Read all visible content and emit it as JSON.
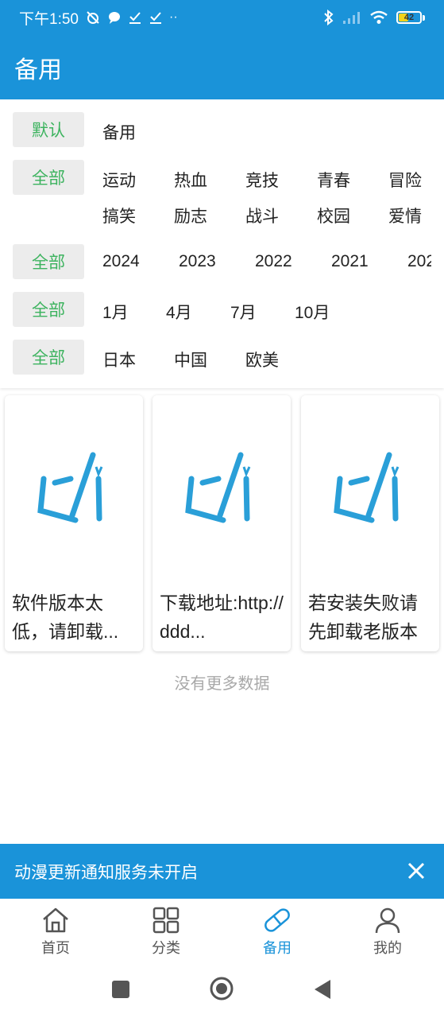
{
  "status_bar": {
    "time": "下午1:50",
    "battery": "42"
  },
  "app_bar": {
    "title": "备用"
  },
  "filters": {
    "source": {
      "tag": "默认",
      "options": [
        "备用"
      ]
    },
    "genre": {
      "tag": "全部",
      "options": [
        "运动",
        "热血",
        "竞技",
        "青春",
        "冒险",
        "搞笑",
        "励志",
        "战斗",
        "校园",
        "爱情"
      ]
    },
    "year": {
      "tag": "全部",
      "options": [
        "2024",
        "2023",
        "2022",
        "2021",
        "202"
      ]
    },
    "month": {
      "tag": "全部",
      "options": [
        "1月",
        "4月",
        "7月",
        "10月"
      ]
    },
    "region": {
      "tag": "全部",
      "options": [
        "日本",
        "中国",
        "欧美"
      ]
    }
  },
  "cards": [
    {
      "title": "软件版本太低，请卸载..."
    },
    {
      "title": "下载地址:http://ddd..."
    },
    {
      "title": "若安装失败请先卸载老版本"
    }
  ],
  "no_more_text": "没有更多数据",
  "notice": {
    "text": "动漫更新通知服务未开启"
  },
  "bottom_nav": {
    "items": [
      {
        "label": "首页",
        "icon": "home-icon"
      },
      {
        "label": "分类",
        "icon": "grid-icon"
      },
      {
        "label": "备用",
        "icon": "pill-icon",
        "active": true
      },
      {
        "label": "我的",
        "icon": "person-icon"
      }
    ]
  },
  "colors": {
    "primary": "#1a93d9",
    "tag_green": "#3db35f",
    "tag_bg": "#ececec",
    "muted": "#a8a8a8"
  }
}
